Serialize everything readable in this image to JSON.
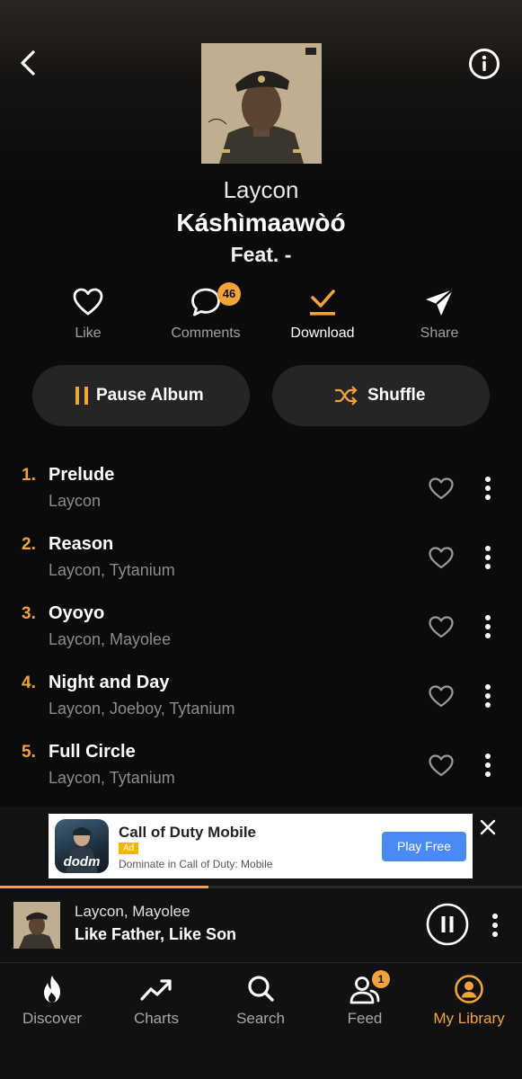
{
  "header": {
    "back_icon": "chevron-left-icon",
    "info_icon": "info-icon"
  },
  "album": {
    "artist": "Laycon",
    "title": "Káshìmaawòó",
    "feat": "Feat. -"
  },
  "actions": [
    {
      "label": "Like",
      "icon": "heart-outline-icon"
    },
    {
      "label": "Comments",
      "icon": "chat-bubble-icon",
      "badge": "46"
    },
    {
      "label": "Download",
      "icon": "download-check-icon"
    },
    {
      "label": "Share",
      "icon": "send-icon"
    }
  ],
  "controls": {
    "pause_label": "Pause Album",
    "shuffle_label": "Shuffle"
  },
  "tracks": [
    {
      "num": "1.",
      "title": "Prelude",
      "artists": "Laycon"
    },
    {
      "num": "2.",
      "title": "Reason",
      "artists": "Laycon, Tytanium"
    },
    {
      "num": "3.",
      "title": "Oyoyo",
      "artists": "Laycon, Mayolee"
    },
    {
      "num": "4.",
      "title": "Night and Day",
      "artists": "Laycon, Joeboy, Tytanium"
    },
    {
      "num": "5.",
      "title": "Full Circle",
      "artists": "Laycon, Tytanium"
    }
  ],
  "ad": {
    "title": "Call of Duty Mobile",
    "tag": "Ad",
    "description": "Dominate in Call of Duty: Mobile",
    "cta": "Play Free",
    "icon_text": "dodm"
  },
  "now_playing": {
    "artists": "Laycon, Mayolee",
    "title": "Like Father, Like Son",
    "progress": 0.4
  },
  "tabs": [
    {
      "label": "Discover",
      "icon": "flame-icon"
    },
    {
      "label": "Charts",
      "icon": "trend-up-icon"
    },
    {
      "label": "Search",
      "icon": "search-icon"
    },
    {
      "label": "Feed",
      "icon": "users-icon",
      "badge": "1"
    },
    {
      "label": "My Library",
      "icon": "user-circle-icon",
      "active": true
    }
  ],
  "colors": {
    "accent": "#f2a33a",
    "background": "#0b0b0b",
    "pill": "#252525",
    "muted_text": "#8c8c8c"
  }
}
